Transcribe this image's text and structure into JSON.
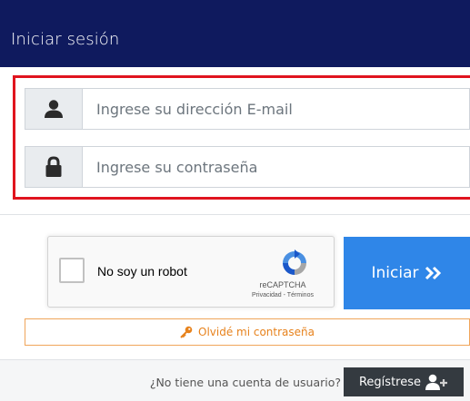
{
  "header": {
    "title": "Iniciar sesión"
  },
  "form": {
    "email": {
      "placeholder": "Ingrese su dirección E-mail",
      "value": "",
      "icon": "user-icon"
    },
    "password": {
      "placeholder": "Ingrese su contraseña",
      "value": "",
      "icon": "lock-icon"
    }
  },
  "recaptcha": {
    "label": "No soy un robot",
    "brand": "reCAPTCHA",
    "links": "Privacidad - Términos"
  },
  "login_button": {
    "label": "Iniciar",
    "icon": "double-chevron-right-icon"
  },
  "forgot_button": {
    "label": "Olvidé mi contraseña",
    "icon": "key-icon"
  },
  "footer": {
    "question": "¿No tiene una cuenta de usuario?",
    "register_label": "Regístrese",
    "register_icon": "user-plus-icon"
  },
  "colors": {
    "header_bg": "#0f1a5e",
    "highlight": "#e0141e",
    "primary": "#2f86e8",
    "warning": "#e7821c",
    "dark": "#343a40"
  }
}
